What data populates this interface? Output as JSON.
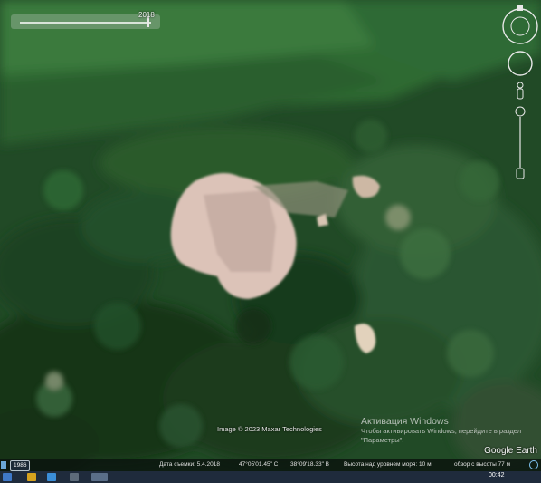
{
  "time_slider": {
    "date": "2018"
  },
  "map_attribution": "Image © 2023 Maxar Technologies",
  "activation": {
    "title": "Активация Windows",
    "subtitle": "Чтобы активировать Windows, перейдите в раздел \"Параметры\"."
  },
  "logo": "Google Earth",
  "status_bar": {
    "year": "1986",
    "capture_date": "Дата съемки: 5.4.2018",
    "latitude": "47°05'01.45\" С",
    "longitude": "38°09'18.33\" В",
    "elevation": "Высота над уровнем моря: 10 м",
    "eye_alt": "обзор с высоты 77 м"
  },
  "taskbar": {
    "clock": "00:42"
  },
  "icons": {
    "compass": "compass-icon",
    "look": "look-joystick-icon",
    "pegman": "pegman-icon",
    "zoom_slider": "zoom-slider-icon"
  },
  "colors": {
    "accent": "#7fc2ef",
    "taskbar": "#1f2b3c"
  }
}
